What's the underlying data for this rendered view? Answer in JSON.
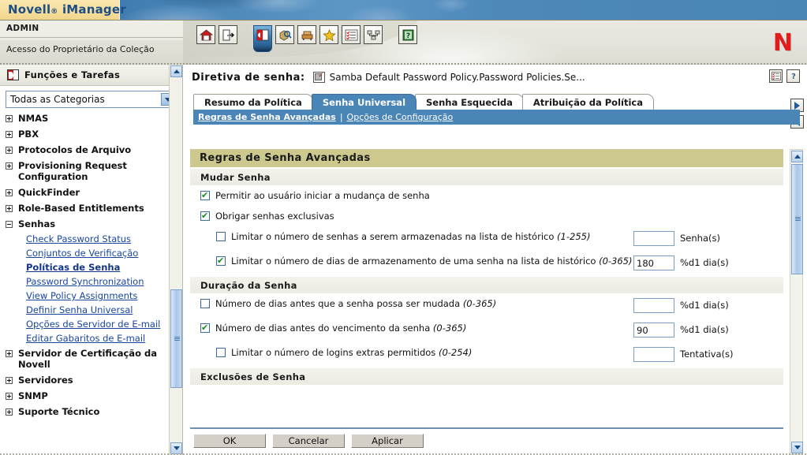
{
  "brand": {
    "product": "Novell",
    "registered": "®",
    "suite": "iManager",
    "logo_letter": "N",
    "logo_color": "#e21b1b",
    "accent_blue": "#4a85b8",
    "section_olive": "#ccc88e"
  },
  "header": {
    "user": "ADMIN",
    "collection": "Acesso do Proprietário da Coleção",
    "toolbar": [
      {
        "name": "home-icon",
        "glyph": "⌂",
        "title": "Home"
      },
      {
        "name": "exit-icon",
        "glyph": "⎋",
        "title": "Exit"
      },
      {
        "name": "roles-and-tasks-icon",
        "glyph": "◧",
        "title": "Funções e Tarefas"
      },
      {
        "name": "object-view-icon",
        "glyph": "⌕",
        "title": "Exibir Objetos"
      },
      {
        "name": "configure-icon",
        "glyph": "▤",
        "title": "Configurar"
      },
      {
        "name": "favorites-star-icon",
        "glyph": "★",
        "title": "Favoritos"
      },
      {
        "name": "checklist-icon",
        "glyph": "☷",
        "title": "Lista"
      },
      {
        "name": "network-icon",
        "glyph": "⧉",
        "title": "Rede"
      },
      {
        "name": "help-book-icon",
        "glyph": "?",
        "title": "Ajuda"
      }
    ]
  },
  "sidebar": {
    "title": "Funções e Tarefas",
    "category_select": {
      "value": "Todas as Categorias",
      "options": [
        "Todas as Categorias"
      ]
    },
    "tree": [
      {
        "label": "NMAS",
        "expanded": false,
        "children": []
      },
      {
        "label": "PBX",
        "expanded": false,
        "children": []
      },
      {
        "label": "Protocolos de Arquivo",
        "expanded": false,
        "children": []
      },
      {
        "label": "Provisioning Request Configuration",
        "expanded": false,
        "children": []
      },
      {
        "label": "QuickFinder",
        "expanded": false,
        "children": []
      },
      {
        "label": "Role-Based Entitlements",
        "expanded": false,
        "children": []
      },
      {
        "label": "Senhas",
        "expanded": true,
        "children": [
          {
            "label": "Check Password Status",
            "selected": false
          },
          {
            "label": "Conjuntos de Verificação",
            "selected": false
          },
          {
            "label": "Políticas de Senha",
            "selected": true
          },
          {
            "label": "Password Synchronization",
            "selected": false
          },
          {
            "label": "View Policy Assignments",
            "selected": false
          },
          {
            "label": "Definir Senha Universal",
            "selected": false
          },
          {
            "label": "Opções de Servidor de E-mail",
            "selected": false
          },
          {
            "label": "Editar Gabaritos de E-mail",
            "selected": false
          }
        ]
      },
      {
        "label": "Servidor de Certificação da Novell",
        "expanded": false,
        "children": []
      },
      {
        "label": "Servidores",
        "expanded": false,
        "children": []
      },
      {
        "label": "SNMP",
        "expanded": false,
        "children": []
      },
      {
        "label": "Suporte Técnico",
        "expanded": false,
        "children": []
      }
    ]
  },
  "content": {
    "page_title": "Diretiva de senha:",
    "object_name": "Samba Default Password Policy.Password Policies.Se...",
    "header_icons": [
      {
        "name": "view-objects-icon",
        "glyph": "▤"
      },
      {
        "name": "help-icon",
        "glyph": "?"
      }
    ],
    "tabs": [
      {
        "label": "Resumo da Política",
        "active": false
      },
      {
        "label": "Senha Universal",
        "active": true
      },
      {
        "label": "Senha Esquecida",
        "active": false
      },
      {
        "label": "Atribuição da Política",
        "active": false
      }
    ],
    "subtabs": [
      {
        "label": "Regras de Senha Avançadas",
        "selected": true
      },
      {
        "label": "Opções de Configuração",
        "selected": false
      }
    ],
    "subtab_separator": "|",
    "nav_arrows": [
      {
        "name": "next-page-arrow",
        "direction": "right"
      },
      {
        "name": "previous-page-arrow",
        "direction": "left"
      }
    ],
    "section_title": "Regras de Senha Avançadas",
    "groups": [
      {
        "title": "Mudar Senha",
        "rows": [
          {
            "checked": true,
            "indent": false,
            "label": "Permitir ao usuário iniciar a mudança de senha",
            "range": "",
            "has_input": false,
            "value": "",
            "unit": ""
          },
          {
            "checked": true,
            "indent": false,
            "label": "Obrigar senhas exclusivas",
            "range": "",
            "has_input": false,
            "value": "",
            "unit": ""
          },
          {
            "checked": false,
            "indent": true,
            "label": "Limitar o número de senhas a serem armazenadas na lista de histórico",
            "range": "(1-255)",
            "has_input": true,
            "value": "",
            "unit": "Senha(s)"
          },
          {
            "checked": true,
            "indent": true,
            "label": "Limitar o número de dias de armazenamento de uma senha na lista de histórico",
            "range": "(0-365)",
            "has_input": true,
            "value": "180",
            "unit": "%d1 dia(s)"
          }
        ]
      },
      {
        "title": "Duração da Senha",
        "rows": [
          {
            "checked": false,
            "indent": false,
            "label": "Número de dias antes que a senha possa ser mudada",
            "range": "(0-365)",
            "has_input": true,
            "value": "",
            "unit": "%d1 dia(s)"
          },
          {
            "checked": true,
            "indent": false,
            "label": "Número de dias antes do vencimento da senha",
            "range": "(0-365)",
            "has_input": true,
            "value": "90",
            "unit": "%d1 dia(s)"
          },
          {
            "checked": false,
            "indent": true,
            "label": "Limitar o número de logins extras permitidos",
            "range": "(0-254)",
            "has_input": true,
            "value": "",
            "unit": "Tentativa(s)"
          }
        ]
      },
      {
        "title": "Exclusões de Senha",
        "rows": []
      }
    ],
    "buttons": [
      {
        "label": "OK",
        "name": "ok-button"
      },
      {
        "label": "Cancelar",
        "name": "cancel-button"
      },
      {
        "label": "Aplicar",
        "name": "apply-button"
      }
    ]
  }
}
